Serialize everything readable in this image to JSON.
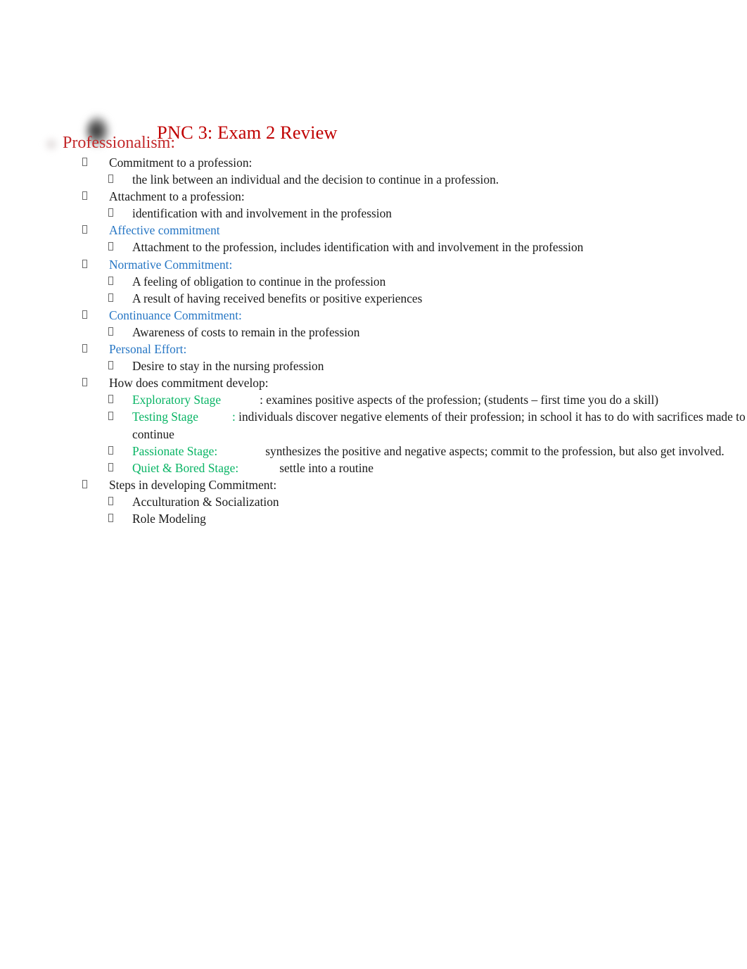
{
  "document": {
    "title": "PNC 3: Exam 2 Review",
    "title_color": "#C00000",
    "heading_color": "#C3292B",
    "blue_color": "#2676C4",
    "green_color": "#07B464",
    "background": "#ffffff"
  },
  "icons": {
    "title_bullet": "blurred-dark-circle-image",
    "heading_bullet": "blurred-light-circle-image",
    "list_bullet": "missing-glyph-box"
  },
  "section": {
    "heading": "Professionalism:"
  },
  "outline": [
    {
      "level": 1,
      "text": "Commitment to a profession:"
    },
    {
      "level": 2,
      "text": "the link between an individual and the decision to continue in a profession."
    },
    {
      "level": 1,
      "text": "Attachment to a profession:"
    },
    {
      "level": 2,
      "text": "identification with and involvement in the profession"
    },
    {
      "level": 1,
      "text": "Affective commitment",
      "color": "blue"
    },
    {
      "level": 2,
      "text": "Attachment to the profession, includes identification with and involvement in the profession"
    },
    {
      "level": 1,
      "text": "Normative Commitment:",
      "color": "blue"
    },
    {
      "level": 2,
      "text": "A feeling of obligation to continue in the profession"
    },
    {
      "level": 2,
      "text": "A result of having received benefits or positive experiences"
    },
    {
      "level": 1,
      "text": "Continuance Commitment:",
      "color": "blue"
    },
    {
      "level": 2,
      "text": "Awareness of costs to remain in the profession"
    },
    {
      "level": 1,
      "text": "Personal Effort:",
      "color": "blue"
    },
    {
      "level": 2,
      "text": "Desire to stay in the nursing profession"
    },
    {
      "level": 1,
      "text": "How does commitment develop:"
    },
    {
      "level": 2,
      "label": "Exploratory Stage",
      "label_color": "green",
      "rest": ": examines positive aspects of the profession; (students – first time you do a skill)"
    },
    {
      "level": 2,
      "label": "Testing Stage",
      "label_color": "green",
      "label_suffix": ":",
      "rest": " individuals discover negative elements of their profession; in school it has to do with sacrifices made to continue"
    },
    {
      "level": 2,
      "label": "Passionate Stage:",
      "label_color": "green",
      "rest": "synthesizes the positive and negative aspects; commit to the profession, but also get involved."
    },
    {
      "level": 2,
      "label": "Quiet & Bored Stage:",
      "label_color": "green",
      "rest": "settle into a routine"
    },
    {
      "level": 1,
      "text": "Steps in developing Commitment:"
    },
    {
      "level": 2,
      "text": "Acculturation & Socialization"
    },
    {
      "level": 2,
      "text": "Role Modeling"
    }
  ]
}
